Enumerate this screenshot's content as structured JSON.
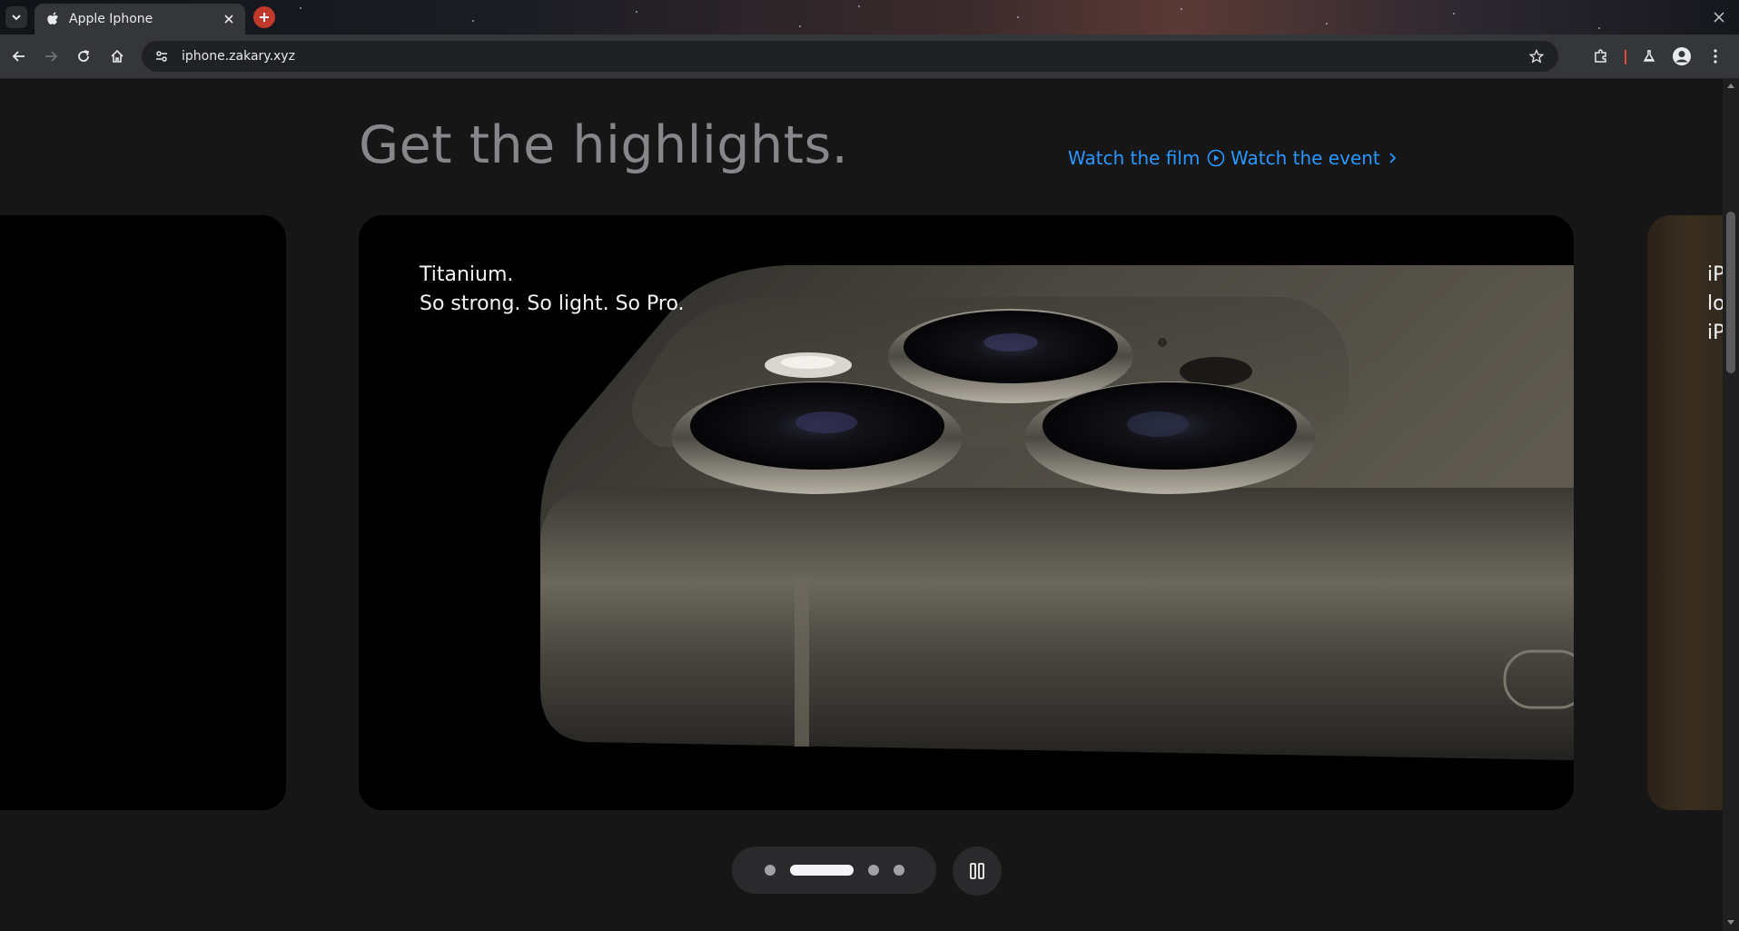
{
  "browser": {
    "tab_title": "Apple Iphone",
    "url": "iphone.zakary.xyz",
    "accent_new_tab": "#c0392b"
  },
  "page": {
    "heading": "Get the highlights.",
    "links": {
      "film": "Watch the film",
      "event": "Watch the event"
    },
    "slides": {
      "main_caption_line1": "Titanium.",
      "main_caption_line2": "So strong. So light. So Pro.",
      "right_caption_line1": "iP",
      "right_caption_line2": "lo",
      "right_caption_line3": "iP"
    },
    "carousel": {
      "dot_count": 4,
      "active_index": 1
    }
  },
  "colors": {
    "link_blue": "#2997ff",
    "background": "#161617",
    "heading_gray": "#86868b"
  }
}
